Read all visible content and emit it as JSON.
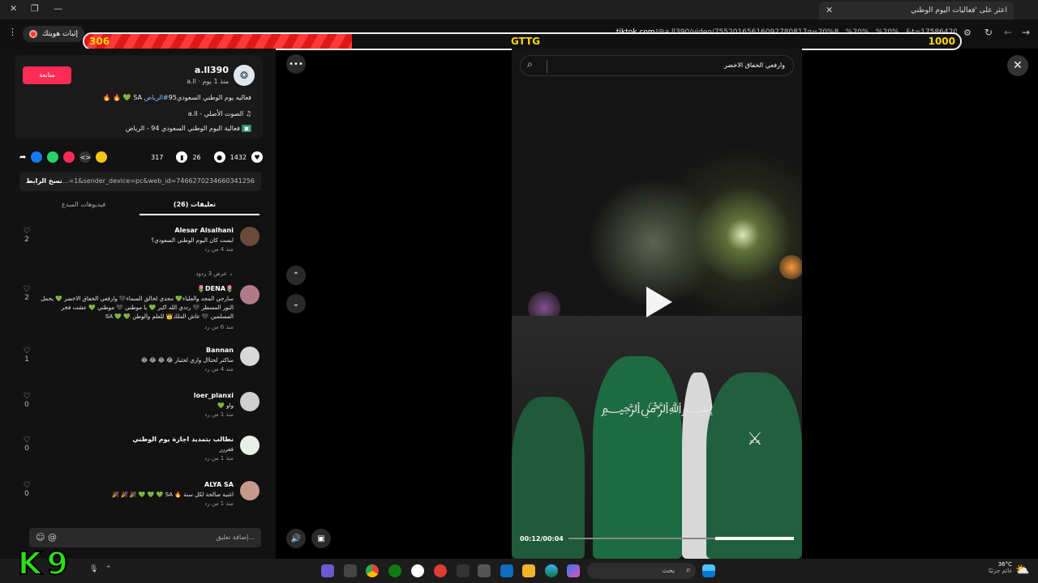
{
  "browser": {
    "tab_title": "اعثر على 'فعاليات اليوم الوطني",
    "url_host": "tiktok.com",
    "url_rest": "/@a.ll390/video/75520165616092780817q=20%8...%20%...%20%...&t=1758642016226",
    "recorder_label": "إثبات هويتك"
  },
  "scorebar": {
    "left_score": "306",
    "center_label": "GTTG",
    "right_score": "1000",
    "fill_fraction": 0.306
  },
  "author": {
    "username": "a.ll390",
    "handle": "a.ll",
    "time_ago": "منذ 1 يوم",
    "follow_label": "متابعة",
    "caption": "فعاليه يوم الوطني السعودي95",
    "hashtag": "#الرياض",
    "caption_tail": "SA 💚 🔥 🔥",
    "sound": "الصوت الأصلي - a.ll",
    "event": "فعالية اليوم الوطني السعودي 94 - الرياض"
  },
  "actions": {
    "likes": "1432",
    "comments": "26",
    "saves": "317"
  },
  "link": {
    "copy_label": "نسخ الرابط",
    "text": "...=1&sender_device=pc&web_id=7466270234660341256"
  },
  "tabs": {
    "comments": "تعليقات (26)",
    "creator_videos": "فيديوهات المبدع"
  },
  "comments": [
    {
      "name": "Alesar Alsalhani",
      "text": "ايست كان اليوم الوطني السعودي؟",
      "meta": "منذ 4 س    رد",
      "likes": "2",
      "avatar": "#6a4a3a"
    },
    {
      "name": "🌷DENA🌷",
      "text": "سارحي المجد والعلياء💚 مجدي لخالق السماء🖤 وارفعي الخفاق الاخضر 💚 يحمل النور المسطر 🖤 رددي الله اكبر 💚 يا موطني 🖤 موطني 💚 عشت فخر المسلمين 🖤 عاش الملك👑 للعلم والوطن 💚 💚 SA",
      "meta": "منذ 6 س    رد",
      "likes": "2",
      "avatar": "#b07a8a"
    },
    {
      "name": "Bannan",
      "text": "ساكنر لحتاال واري لحثبار 😂 😂 😂 😂",
      "meta": "منذ 4 س    رد",
      "likes": "1",
      "avatar": "#d8d8d8"
    },
    {
      "name": "loer_planxi",
      "text": "واو 💚",
      "meta": "منذ 1 س    رد",
      "likes": "0",
      "avatar": "#cfcfcf"
    },
    {
      "name": "نطالب بتمديد اجازة يوم الوطني",
      "text": "فغررر",
      "meta": "منذ 1 س    رد",
      "likes": "0",
      "avatar": "#e8efe8"
    },
    {
      "name": "ALYA SA",
      "text": "اغنية صالحة لكل سنة 🔥 SA 💚 💚 💚 🎉 🎉 🎉",
      "meta": "منذ 1 س    رد",
      "likes": "0",
      "avatar": "#c49a8a"
    }
  ],
  "replies_label": "عرض 3 ردود",
  "comment_placeholder": "إضافة تعليق...",
  "video": {
    "search_query": "وارفعي الخفاق الاخضر",
    "time": "00:12/00:04",
    "progress": 0.65
  },
  "taskbar": {
    "search_label": "بحث",
    "weather_temp": "36°C",
    "weather_desc": "غائم جزئيًا"
  },
  "overlay_logo": "K9"
}
